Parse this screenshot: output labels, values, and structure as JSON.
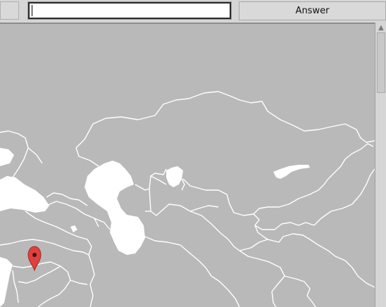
{
  "toolbar": {
    "input_value": "",
    "input_placeholder": "",
    "answer_label": "Answer"
  },
  "map": {
    "land_color": "#b9b9b9",
    "water_color": "#ffffff",
    "border_color": "#ffffff",
    "marker_color": "#e0403e",
    "marker_icon": "map-pin-icon"
  },
  "scrollbar": {
    "up_arrow_icon": "chevron-up-icon"
  }
}
